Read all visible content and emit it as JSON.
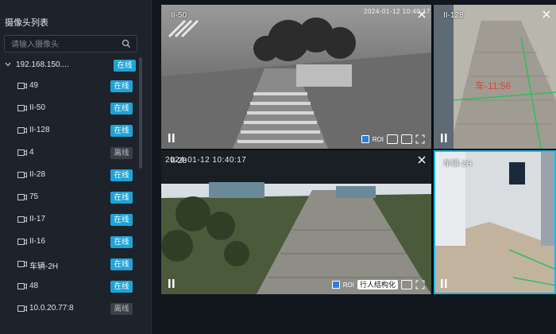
{
  "sidebar": {
    "title": "摄像头列表",
    "search_placeholder": "请输入摄像头",
    "root": {
      "label": "192.168.150....",
      "status": "在线"
    },
    "cameras": [
      {
        "name": "49",
        "status": "在线",
        "online": true
      },
      {
        "name": "II-50",
        "status": "在线",
        "online": true
      },
      {
        "name": "II-128",
        "status": "在线",
        "online": true
      },
      {
        "name": "4",
        "status": "离线",
        "online": false
      },
      {
        "name": "II-28",
        "status": "在线",
        "online": true
      },
      {
        "name": "75",
        "status": "在线",
        "online": true
      },
      {
        "name": "II-17",
        "status": "在线",
        "online": true
      },
      {
        "name": "II-16",
        "status": "在线",
        "online": true
      },
      {
        "name": "车辆-2H",
        "status": "在线",
        "online": true
      },
      {
        "name": "48",
        "status": "在线",
        "online": true
      },
      {
        "name": "10.0.20.77:8",
        "status": "离线",
        "online": false
      }
    ]
  },
  "tiles": {
    "t1": {
      "name": "II-50",
      "timestamp": "2024-01-12 10:40:17",
      "roi": "ROI"
    },
    "t2": {
      "name": "II-128",
      "overlay": "车-11:56"
    },
    "t3": {
      "name": "II-28",
      "timestamp": "2024-01-12 10:40:17",
      "roi": "ROI",
      "select": "行人结构化"
    },
    "t4": {
      "name": "车辆-2H"
    }
  },
  "colors": {
    "online": "#1fa3d6",
    "offline": "#3a404a",
    "selected_border": "#19b8e8"
  }
}
